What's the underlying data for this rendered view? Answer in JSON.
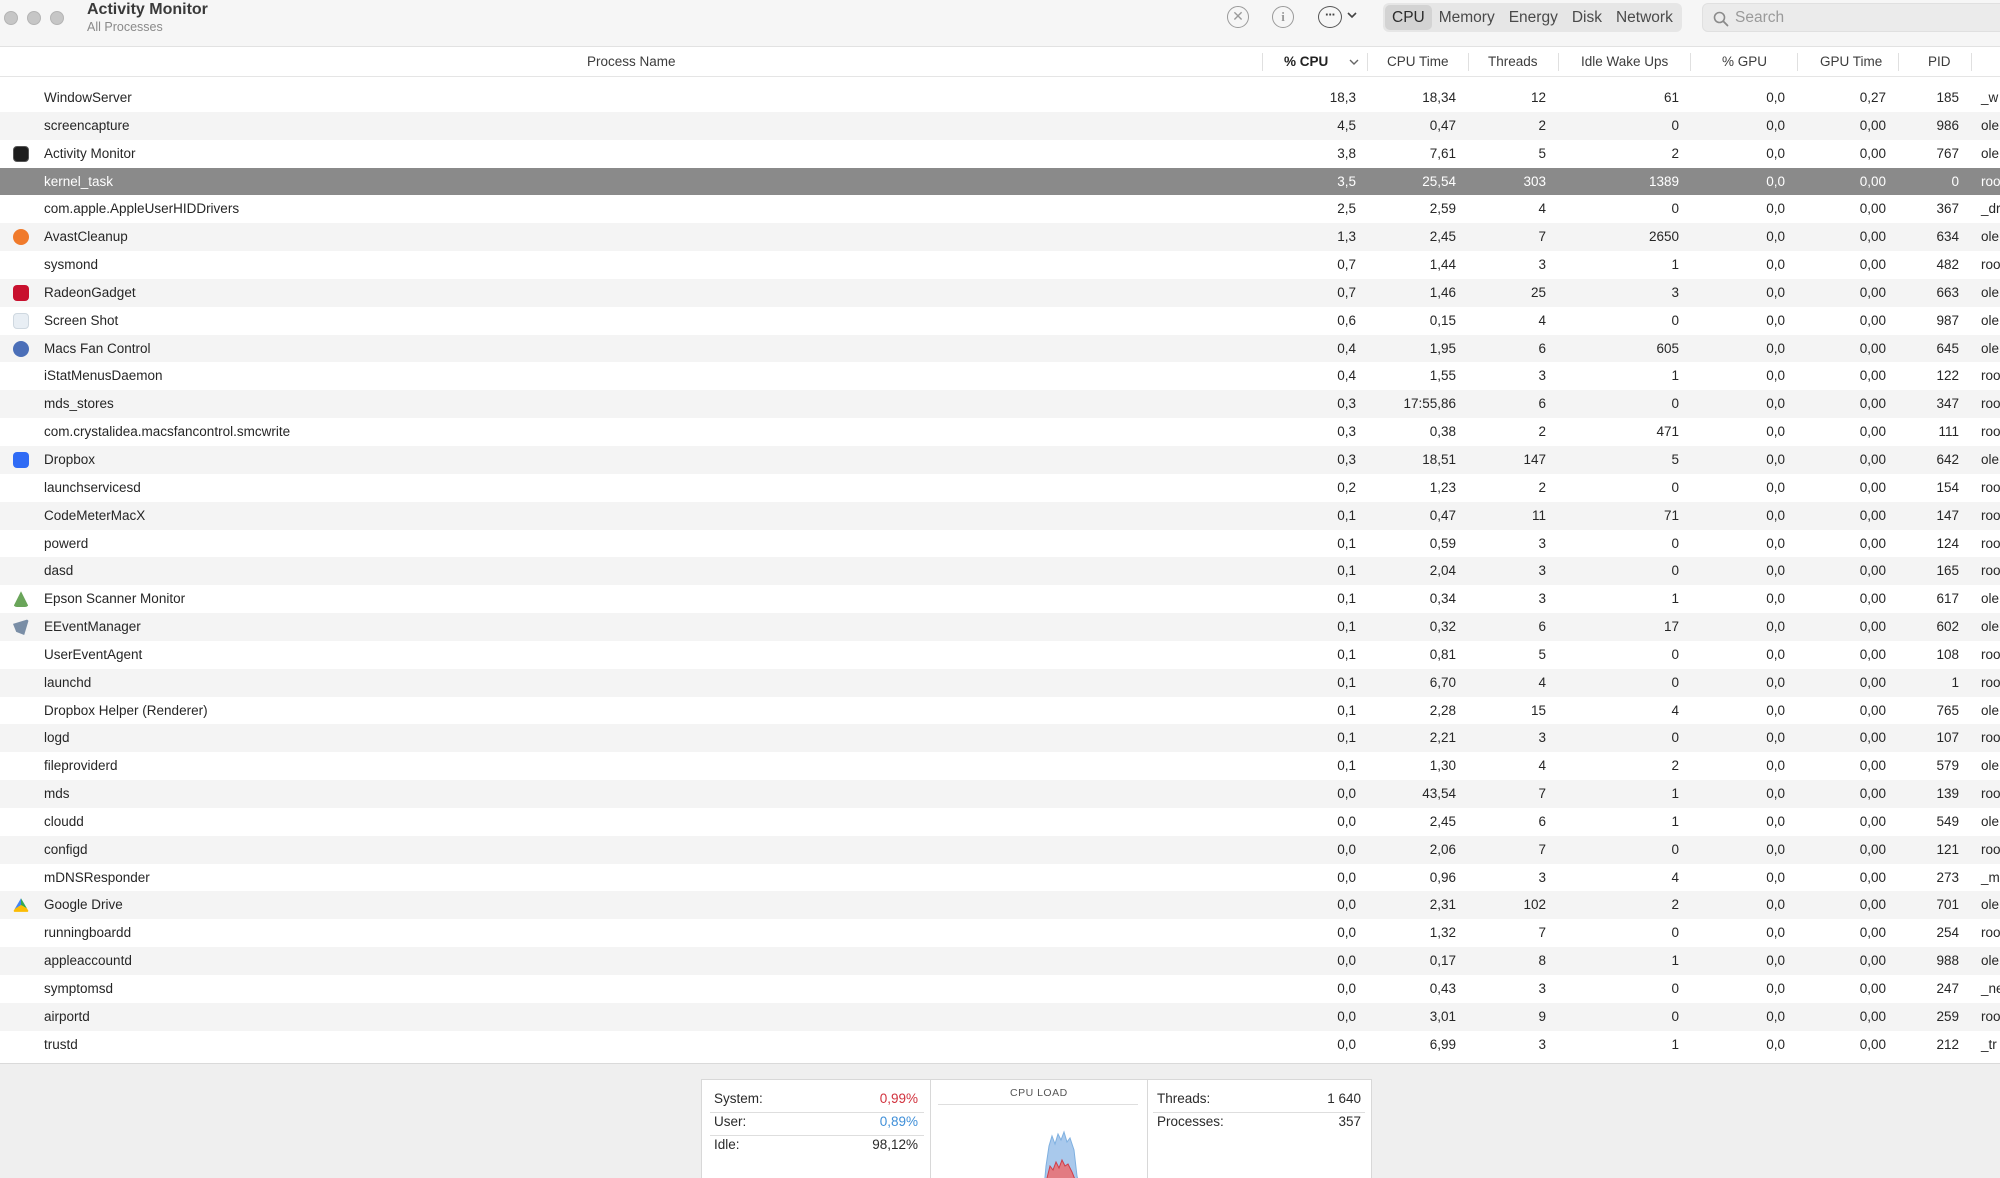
{
  "window": {
    "title": "Activity Monitor",
    "subtitle": "All Processes"
  },
  "toolbar": {
    "stop_icon": "x-circle-icon",
    "info_icon": "info-icon",
    "more_icon": "ellipsis-circle-icon",
    "tabs": [
      {
        "label": "CPU",
        "active": true
      },
      {
        "label": "Memory",
        "active": false
      },
      {
        "label": "Energy",
        "active": false
      },
      {
        "label": "Disk",
        "active": false
      },
      {
        "label": "Network",
        "active": false
      }
    ],
    "search": {
      "placeholder": "Search",
      "value": ""
    }
  },
  "columns": {
    "name": "Process Name",
    "cpu": "% CPU",
    "cpu_time": "CPU Time",
    "threads": "Threads",
    "idle_wake_ups": "Idle Wake Ups",
    "gpu": "% GPU",
    "gpu_time": "GPU Time",
    "pid": "PID",
    "sorted_by": "% CPU"
  },
  "processes": [
    {
      "name": "WindowServer",
      "cpu": "18,3",
      "cpu_time": "18,34",
      "threads": "12",
      "idle": "61",
      "gpu": "0,0",
      "gpu_time": "0,27",
      "pid": "185",
      "user": "_w",
      "icon": ""
    },
    {
      "name": "screencapture",
      "cpu": "4,5",
      "cpu_time": "0,47",
      "threads": "2",
      "idle": "0",
      "gpu": "0,0",
      "gpu_time": "0,00",
      "pid": "986",
      "user": "ole",
      "icon": ""
    },
    {
      "name": "Activity Monitor",
      "cpu": "3,8",
      "cpu_time": "7,61",
      "threads": "5",
      "idle": "2",
      "gpu": "0,0",
      "gpu_time": "0,00",
      "pid": "767",
      "user": "ole",
      "icon": "activity-monitor-icon"
    },
    {
      "name": "kernel_task",
      "cpu": "3,5",
      "cpu_time": "25,54",
      "threads": "303",
      "idle": "1389",
      "gpu": "0,0",
      "gpu_time": "0,00",
      "pid": "0",
      "user": "roo",
      "icon": "",
      "selected": true
    },
    {
      "name": "com.apple.AppleUserHIDDrivers",
      "cpu": "2,5",
      "cpu_time": "2,59",
      "threads": "4",
      "idle": "0",
      "gpu": "0,0",
      "gpu_time": "0,00",
      "pid": "367",
      "user": "_dr",
      "icon": ""
    },
    {
      "name": "AvastCleanup",
      "cpu": "1,3",
      "cpu_time": "2,45",
      "threads": "7",
      "idle": "2650",
      "gpu": "0,0",
      "gpu_time": "0,00",
      "pid": "634",
      "user": "ole",
      "icon": "avast-cleanup-icon"
    },
    {
      "name": "sysmond",
      "cpu": "0,7",
      "cpu_time": "1,44",
      "threads": "3",
      "idle": "1",
      "gpu": "0,0",
      "gpu_time": "0,00",
      "pid": "482",
      "user": "roo",
      "icon": ""
    },
    {
      "name": "RadeonGadget",
      "cpu": "0,7",
      "cpu_time": "1,46",
      "threads": "25",
      "idle": "3",
      "gpu": "0,0",
      "gpu_time": "0,00",
      "pid": "663",
      "user": "ole",
      "icon": "radeon-gadget-icon"
    },
    {
      "name": "Screen Shot",
      "cpu": "0,6",
      "cpu_time": "0,15",
      "threads": "4",
      "idle": "0",
      "gpu": "0,0",
      "gpu_time": "0,00",
      "pid": "987",
      "user": "ole",
      "icon": "screen-shot-icon"
    },
    {
      "name": "Macs Fan Control",
      "cpu": "0,4",
      "cpu_time": "1,95",
      "threads": "6",
      "idle": "605",
      "gpu": "0,0",
      "gpu_time": "0,00",
      "pid": "645",
      "user": "ole",
      "icon": "macs-fan-control-icon"
    },
    {
      "name": "iStatMenusDaemon",
      "cpu": "0,4",
      "cpu_time": "1,55",
      "threads": "3",
      "idle": "1",
      "gpu": "0,0",
      "gpu_time": "0,00",
      "pid": "122",
      "user": "roo",
      "icon": ""
    },
    {
      "name": "mds_stores",
      "cpu": "0,3",
      "cpu_time": "17:55,86",
      "threads": "6",
      "idle": "0",
      "gpu": "0,0",
      "gpu_time": "0,00",
      "pid": "347",
      "user": "roo",
      "icon": ""
    },
    {
      "name": "com.crystalidea.macsfancontrol.smcwrite",
      "cpu": "0,3",
      "cpu_time": "0,38",
      "threads": "2",
      "idle": "471",
      "gpu": "0,0",
      "gpu_time": "0,00",
      "pid": "111",
      "user": "roo",
      "icon": ""
    },
    {
      "name": "Dropbox",
      "cpu": "0,3",
      "cpu_time": "18,51",
      "threads": "147",
      "idle": "5",
      "gpu": "0,0",
      "gpu_time": "0,00",
      "pid": "642",
      "user": "ole",
      "icon": "dropbox-icon"
    },
    {
      "name": "launchservicesd",
      "cpu": "0,2",
      "cpu_time": "1,23",
      "threads": "2",
      "idle": "0",
      "gpu": "0,0",
      "gpu_time": "0,00",
      "pid": "154",
      "user": "roo",
      "icon": ""
    },
    {
      "name": "CodeMeterMacX",
      "cpu": "0,1",
      "cpu_time": "0,47",
      "threads": "11",
      "idle": "71",
      "gpu": "0,0",
      "gpu_time": "0,00",
      "pid": "147",
      "user": "roo",
      "icon": ""
    },
    {
      "name": "powerd",
      "cpu": "0,1",
      "cpu_time": "0,59",
      "threads": "3",
      "idle": "0",
      "gpu": "0,0",
      "gpu_time": "0,00",
      "pid": "124",
      "user": "roo",
      "icon": ""
    },
    {
      "name": "dasd",
      "cpu": "0,1",
      "cpu_time": "2,04",
      "threads": "3",
      "idle": "0",
      "gpu": "0,0",
      "gpu_time": "0,00",
      "pid": "165",
      "user": "roo",
      "icon": ""
    },
    {
      "name": "Epson Scanner Monitor",
      "cpu": "0,1",
      "cpu_time": "0,34",
      "threads": "3",
      "idle": "1",
      "gpu": "0,0",
      "gpu_time": "0,00",
      "pid": "617",
      "user": "ole",
      "icon": "epson-scanner-icon"
    },
    {
      "name": "EEventManager",
      "cpu": "0,1",
      "cpu_time": "0,32",
      "threads": "6",
      "idle": "17",
      "gpu": "0,0",
      "gpu_time": "0,00",
      "pid": "602",
      "user": "ole",
      "icon": "eevent-manager-icon"
    },
    {
      "name": "UserEventAgent",
      "cpu": "0,1",
      "cpu_time": "0,81",
      "threads": "5",
      "idle": "0",
      "gpu": "0,0",
      "gpu_time": "0,00",
      "pid": "108",
      "user": "roo",
      "icon": ""
    },
    {
      "name": "launchd",
      "cpu": "0,1",
      "cpu_time": "6,70",
      "threads": "4",
      "idle": "0",
      "gpu": "0,0",
      "gpu_time": "0,00",
      "pid": "1",
      "user": "roo",
      "icon": ""
    },
    {
      "name": "Dropbox Helper (Renderer)",
      "cpu": "0,1",
      "cpu_time": "2,28",
      "threads": "15",
      "idle": "4",
      "gpu": "0,0",
      "gpu_time": "0,00",
      "pid": "765",
      "user": "ole",
      "icon": ""
    },
    {
      "name": "logd",
      "cpu": "0,1",
      "cpu_time": "2,21",
      "threads": "3",
      "idle": "0",
      "gpu": "0,0",
      "gpu_time": "0,00",
      "pid": "107",
      "user": "roo",
      "icon": ""
    },
    {
      "name": "fileproviderd",
      "cpu": "0,1",
      "cpu_time": "1,30",
      "threads": "4",
      "idle": "2",
      "gpu": "0,0",
      "gpu_time": "0,00",
      "pid": "579",
      "user": "ole",
      "icon": ""
    },
    {
      "name": "mds",
      "cpu": "0,0",
      "cpu_time": "43,54",
      "threads": "7",
      "idle": "1",
      "gpu": "0,0",
      "gpu_time": "0,00",
      "pid": "139",
      "user": "roo",
      "icon": ""
    },
    {
      "name": "cloudd",
      "cpu": "0,0",
      "cpu_time": "2,45",
      "threads": "6",
      "idle": "1",
      "gpu": "0,0",
      "gpu_time": "0,00",
      "pid": "549",
      "user": "ole",
      "icon": ""
    },
    {
      "name": "configd",
      "cpu": "0,0",
      "cpu_time": "2,06",
      "threads": "7",
      "idle": "0",
      "gpu": "0,0",
      "gpu_time": "0,00",
      "pid": "121",
      "user": "roo",
      "icon": ""
    },
    {
      "name": "mDNSResponder",
      "cpu": "0,0",
      "cpu_time": "0,96",
      "threads": "3",
      "idle": "4",
      "gpu": "0,0",
      "gpu_time": "0,00",
      "pid": "273",
      "user": "_m",
      "icon": ""
    },
    {
      "name": "Google Drive",
      "cpu": "0,0",
      "cpu_time": "2,31",
      "threads": "102",
      "idle": "2",
      "gpu": "0,0",
      "gpu_time": "0,00",
      "pid": "701",
      "user": "ole",
      "icon": "google-drive-icon"
    },
    {
      "name": "runningboardd",
      "cpu": "0,0",
      "cpu_time": "1,32",
      "threads": "7",
      "idle": "0",
      "gpu": "0,0",
      "gpu_time": "0,00",
      "pid": "254",
      "user": "roo",
      "icon": ""
    },
    {
      "name": "appleaccountd",
      "cpu": "0,0",
      "cpu_time": "0,17",
      "threads": "8",
      "idle": "1",
      "gpu": "0,0",
      "gpu_time": "0,00",
      "pid": "988",
      "user": "ole",
      "icon": ""
    },
    {
      "name": "symptomsd",
      "cpu": "0,0",
      "cpu_time": "0,43",
      "threads": "3",
      "idle": "0",
      "gpu": "0,0",
      "gpu_time": "0,00",
      "pid": "247",
      "user": "_ne",
      "icon": ""
    },
    {
      "name": "airportd",
      "cpu": "0,0",
      "cpu_time": "3,01",
      "threads": "9",
      "idle": "0",
      "gpu": "0,0",
      "gpu_time": "0,00",
      "pid": "259",
      "user": "roo",
      "icon": ""
    },
    {
      "name": "trustd",
      "cpu": "0,0",
      "cpu_time": "6,99",
      "threads": "3",
      "idle": "1",
      "gpu": "0,0",
      "gpu_time": "0,00",
      "pid": "212",
      "user": "_tr",
      "icon": ""
    }
  ],
  "summary": {
    "system_label": "System:",
    "system_value": "0,99%",
    "user_label": "User:",
    "user_value": "0,89%",
    "idle_label": "Idle:",
    "idle_value": "98,12%",
    "cpu_load_title": "CPU LOAD",
    "threads_label": "Threads:",
    "threads_value": "1 640",
    "processes_label": "Processes:",
    "processes_value": "357",
    "colors": {
      "system": "#d1313d",
      "user": "#3f8fd8"
    }
  }
}
